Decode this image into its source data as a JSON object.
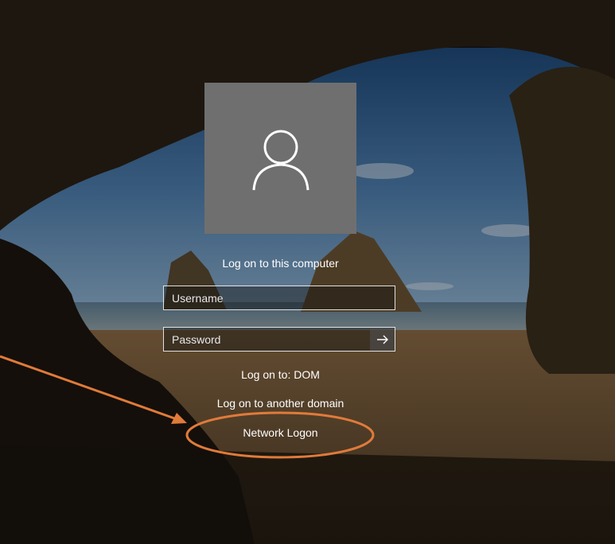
{
  "login": {
    "title": "Log on to this computer",
    "username_placeholder": "Username",
    "password_placeholder": "Password",
    "logon_to_label": "Log on to: DOM",
    "another_domain_label": "Log on to another domain",
    "network_logon_label": "Network Logon"
  },
  "icons": {
    "avatar": "user-avatar-icon",
    "submit": "arrow-right-icon"
  },
  "colors": {
    "avatar_bg": "#6f6f6f",
    "annotation": "#e07b3a",
    "text": "#ffffff"
  }
}
